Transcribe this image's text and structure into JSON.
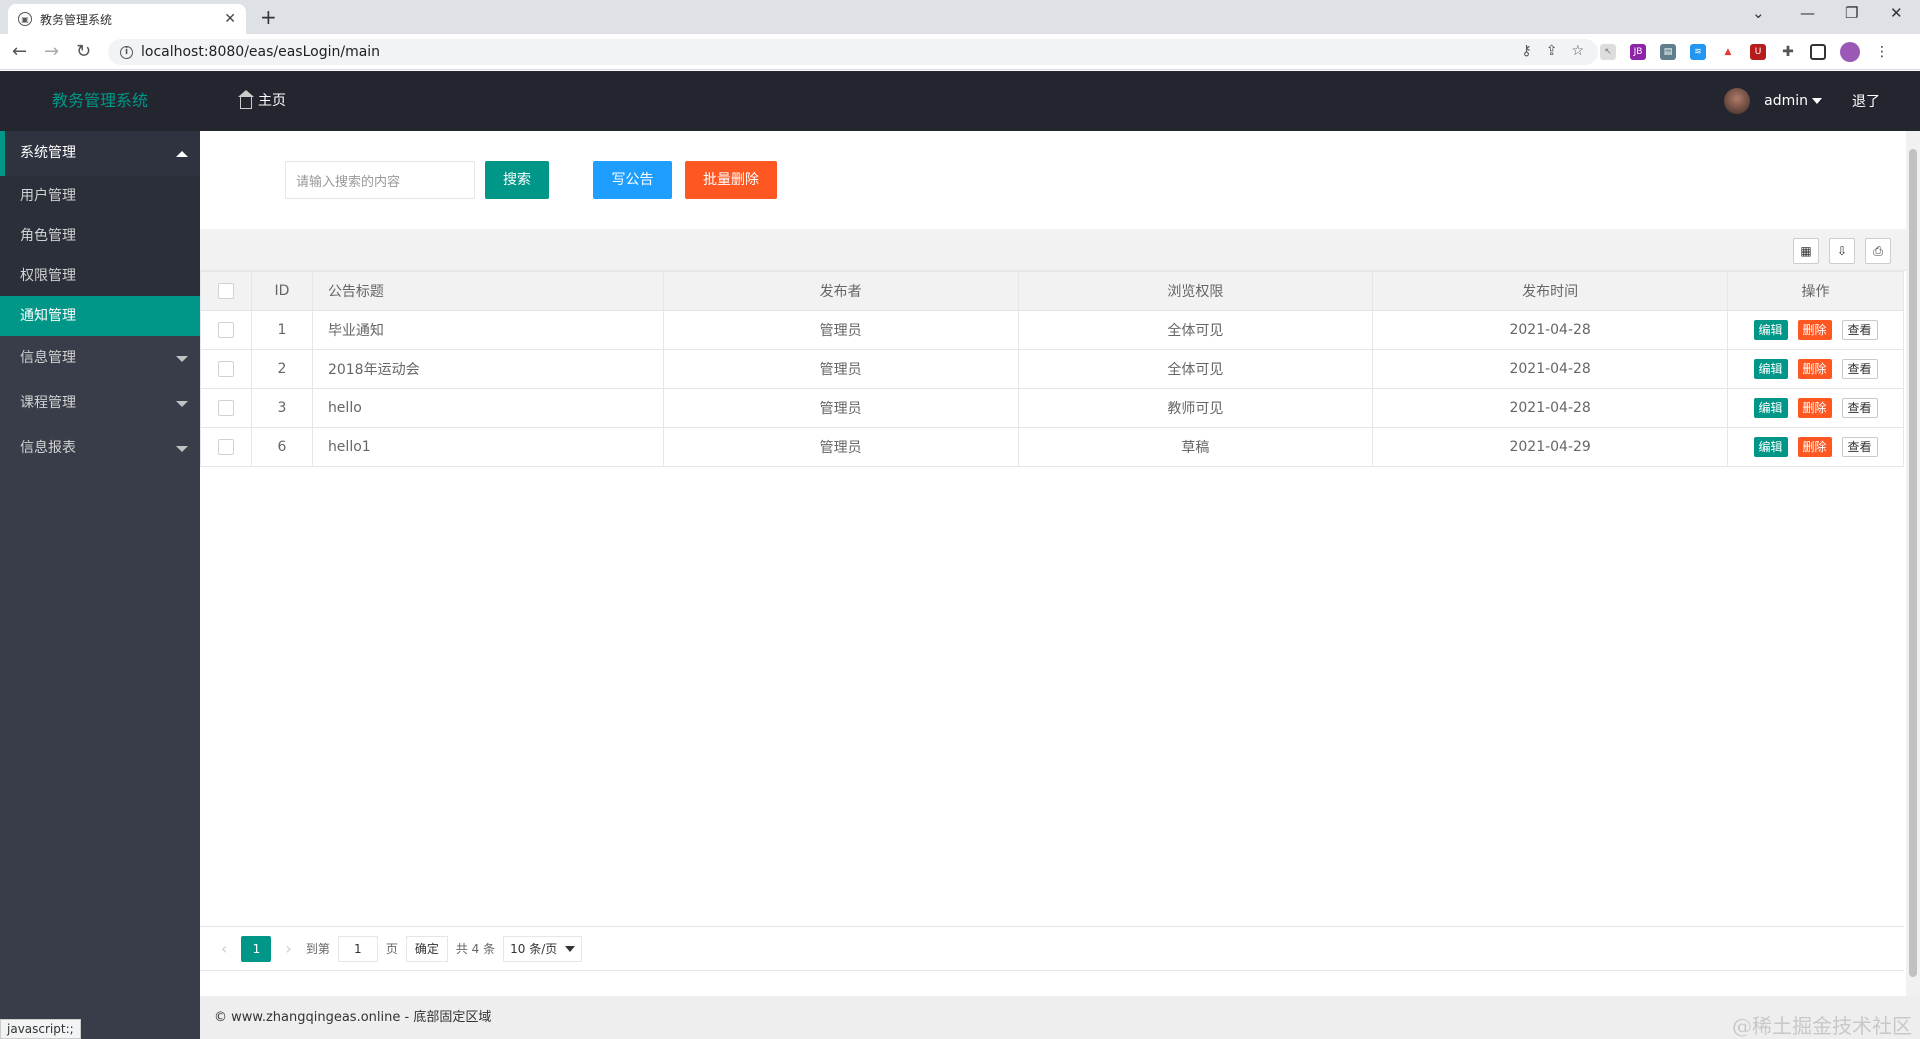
{
  "browser": {
    "tab_title": "教务管理系统",
    "url": "localhost:8080/eas/easLogin/main"
  },
  "header": {
    "logo": "教务管理系统",
    "home": "主页",
    "username": "admin",
    "logout": "退了"
  },
  "sidebar": {
    "groups": [
      {
        "label": "系统管理",
        "open": true,
        "items": [
          "用户管理",
          "角色管理",
          "权限管理",
          "通知管理"
        ],
        "active": "通知管理"
      },
      {
        "label": "信息管理"
      },
      {
        "label": "课程管理"
      },
      {
        "label": "信息报表"
      }
    ]
  },
  "toolbar": {
    "search_placeholder": "请输入搜索的内容",
    "search_label": "搜索",
    "write_label": "写公告",
    "batch_delete_label": "批量删除"
  },
  "table": {
    "columns": [
      "ID",
      "公告标题",
      "发布者",
      "浏览权限",
      "发布时间",
      "操作"
    ],
    "rows": [
      {
        "id": "1",
        "title": "毕业通知",
        "publisher": "管理员",
        "permission": "全体可见",
        "date": "2021-04-28"
      },
      {
        "id": "2",
        "title": "2018年运动会",
        "publisher": "管理员",
        "permission": "全体可见",
        "date": "2021-04-28"
      },
      {
        "id": "3",
        "title": "hello",
        "publisher": "管理员",
        "permission": "教师可见",
        "date": "2021-04-28"
      },
      {
        "id": "6",
        "title": "hello1",
        "publisher": "管理员",
        "permission": "草稿",
        "date": "2021-04-29"
      }
    ],
    "actions": {
      "edit": "编辑",
      "delete": "删除",
      "view": "查看"
    }
  },
  "pager": {
    "current": "1",
    "goto_label": "到第",
    "goto_value": "1",
    "page_label": "页",
    "confirm": "确定",
    "total": "共 4 条",
    "page_size": "10 条/页"
  },
  "footer": {
    "text": "© www.zhangqingeas.online - 底部固定区域"
  },
  "status_tip": "javascript:;",
  "watermark": "@稀土掘金技术社区",
  "colors": {
    "primary": "#009688",
    "blue": "#1e9fff",
    "danger": "#ff5722",
    "header_bg": "#23262e",
    "sidebar_bg": "#393d49"
  }
}
